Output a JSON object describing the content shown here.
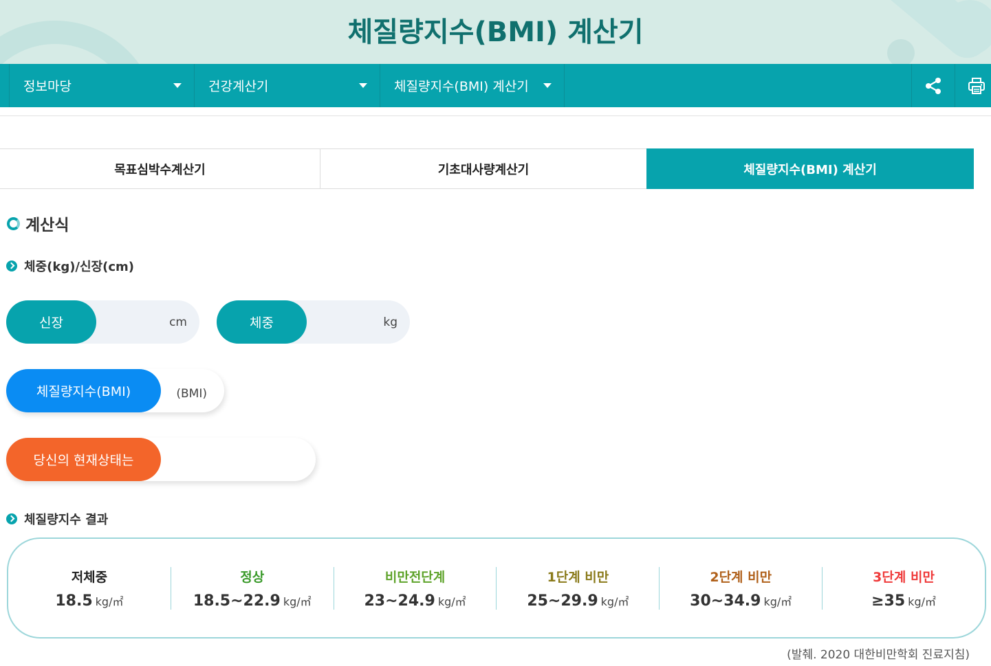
{
  "header": {
    "title": "체질량지수(BMI) 계산기"
  },
  "nav": {
    "items": [
      {
        "label": "정보마당"
      },
      {
        "label": "건강계산기"
      },
      {
        "label": "체질량지수(BMI) 계산기"
      }
    ],
    "share_icon": "share-icon",
    "print_icon": "print-icon"
  },
  "tabs": [
    {
      "label": "목표심박수계산기",
      "active": false
    },
    {
      "label": "기초대사량계산기",
      "active": false
    },
    {
      "label": "체질량지수(BMI) 계산기",
      "active": true
    }
  ],
  "formula": {
    "heading": "계산식",
    "subheading": "체중(kg)/신장(cm)"
  },
  "inputs": {
    "height": {
      "label": "신장",
      "value": "",
      "unit": "cm"
    },
    "weight": {
      "label": "체중",
      "value": "",
      "unit": "kg"
    },
    "bmi": {
      "label": "체질량지수(BMI)",
      "value": "",
      "unit": "(BMI)"
    },
    "status": {
      "label": "당신의 현재상태는",
      "value": ""
    }
  },
  "result": {
    "heading": "체질량지수 결과",
    "categories": [
      {
        "name": "저체중",
        "range": "18.5",
        "unit": "kg/㎡",
        "color": "#222222"
      },
      {
        "name": "정상",
        "range": "18.5~22.9",
        "unit": "kg/㎡",
        "color": "#3a9a2a"
      },
      {
        "name": "비만전단계",
        "range": "23~24.9",
        "unit": "kg/㎡",
        "color": "#5ea32a"
      },
      {
        "name": "1단계 비만",
        "range": "25~29.9",
        "unit": "kg/㎡",
        "color": "#8a7a1a"
      },
      {
        "name": "2단계 비만",
        "range": "30~34.9",
        "unit": "kg/㎡",
        "color": "#b0601a"
      },
      {
        "name": "3단계 비만",
        "range": "≥35",
        "unit": "kg/㎡",
        "color": "#ef3a3a"
      }
    ],
    "source": "(발췌. 2020 대한비만학회 진료지침)"
  },
  "colors": {
    "accent": "#07a3ad",
    "bmi_label": "#0a8cf3",
    "status_label": "#f3652a"
  }
}
